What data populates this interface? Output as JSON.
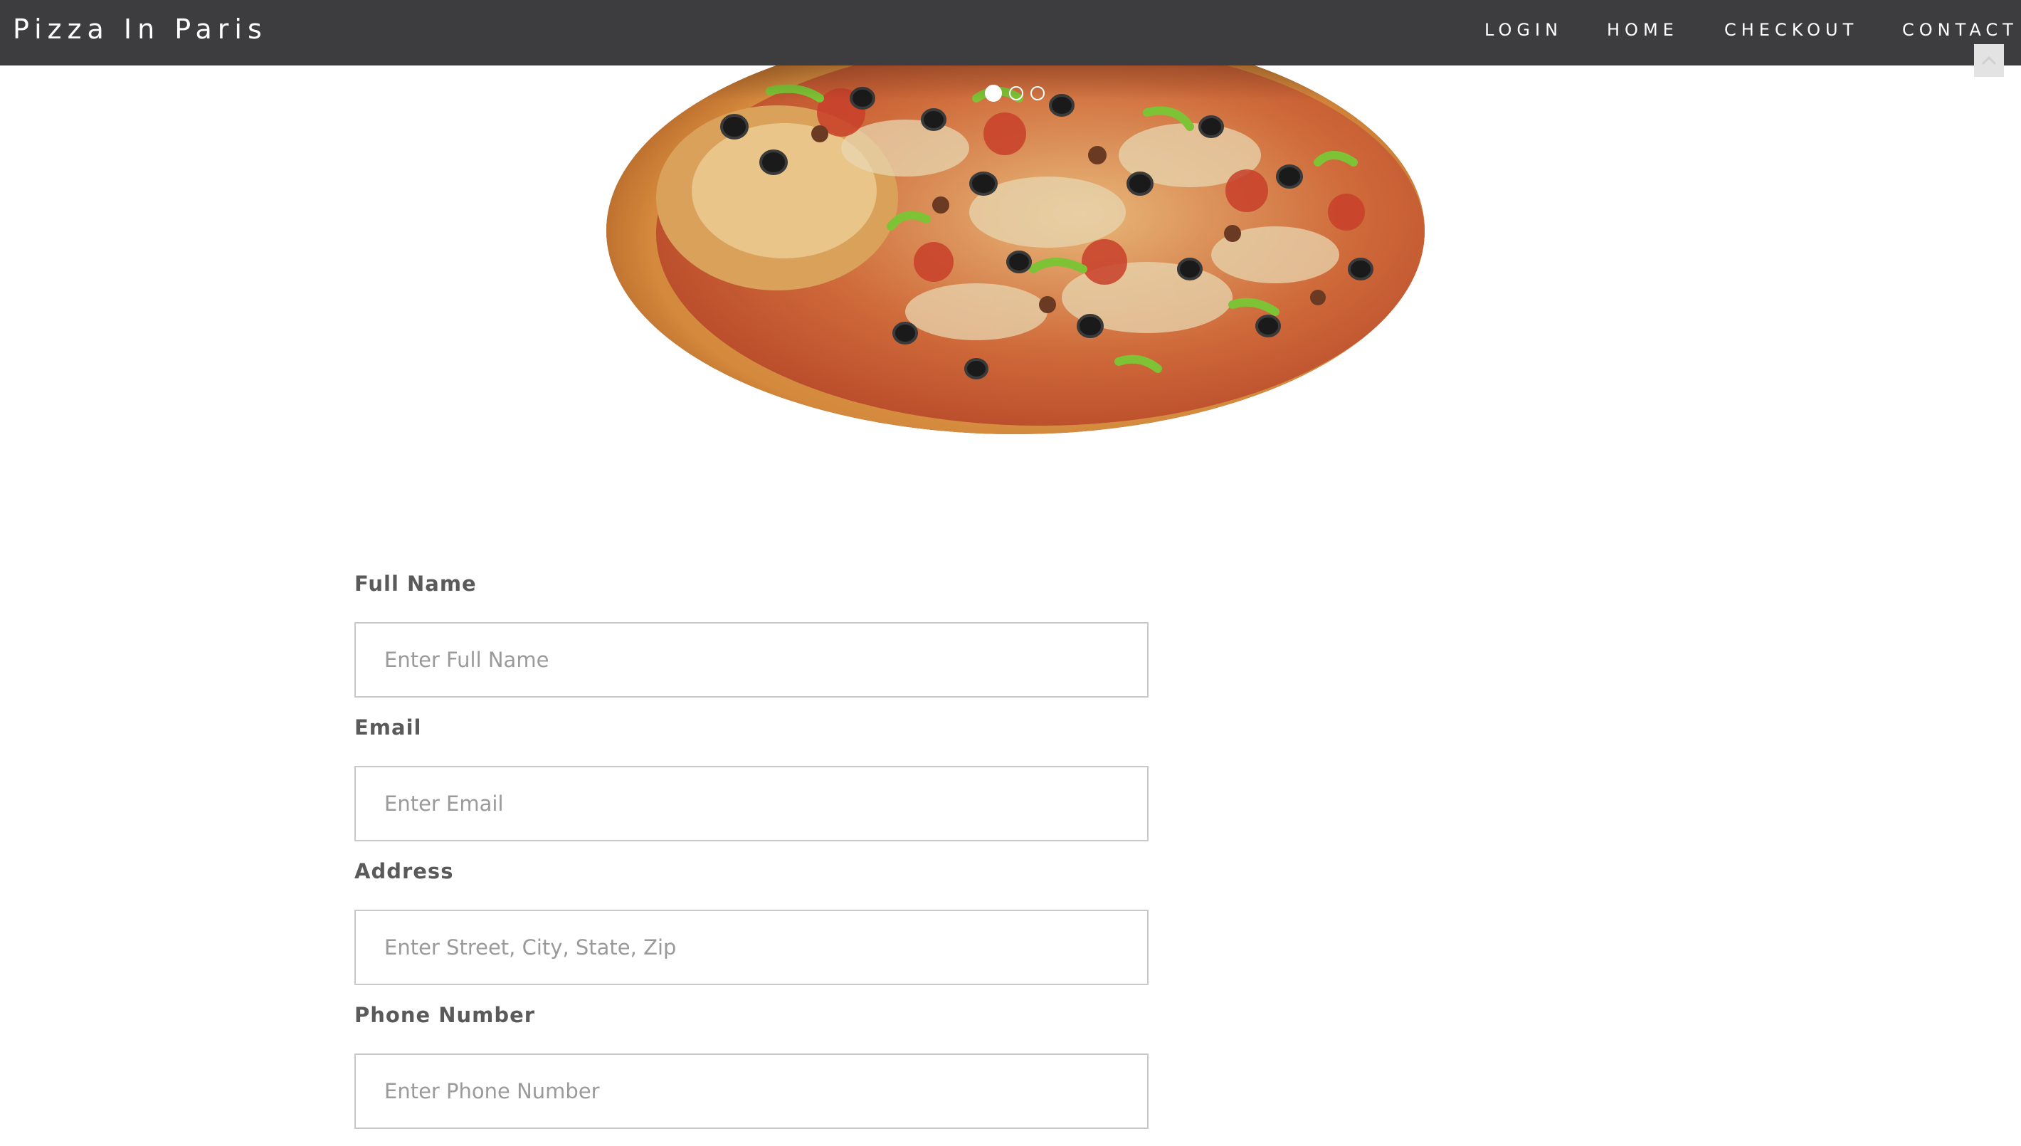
{
  "navbar": {
    "brand": "Pizza In Paris",
    "items": [
      {
        "label": "LOGIN"
      },
      {
        "label": "HOME"
      },
      {
        "label": "CHECKOUT"
      },
      {
        "label": "CONTACT"
      }
    ],
    "background_color": "#3d3d3f"
  },
  "hero": {
    "image": "pizza-image",
    "carousel": {
      "slide_count": 3,
      "active_index": 0
    }
  },
  "form": {
    "fields": [
      {
        "label": "Full Name",
        "placeholder": "Enter Full Name",
        "value": ""
      },
      {
        "label": "Email",
        "placeholder": "Enter Email",
        "value": ""
      },
      {
        "label": "Address",
        "placeholder": "Enter Street, City, State, Zip",
        "value": ""
      },
      {
        "label": "Phone Number",
        "placeholder": "Enter Phone Number",
        "value": ""
      }
    ]
  }
}
